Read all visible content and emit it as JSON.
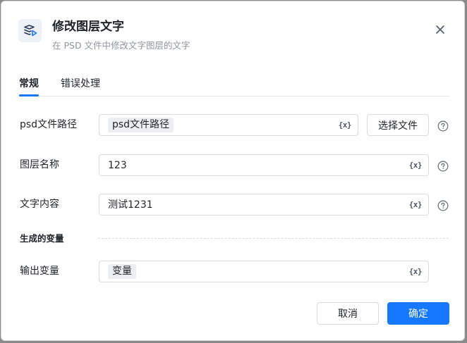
{
  "dialog": {
    "title": "修改图层文字",
    "subtitle": "在 PSD 文件中修改文字图层的文字",
    "icon": "layers-play-icon",
    "close_icon": "close-icon"
  },
  "tabs": [
    {
      "label": "常规",
      "active": true
    },
    {
      "label": "错误处理",
      "active": false
    }
  ],
  "form": {
    "psd_path": {
      "label": "psd文件路径",
      "chip": "psd文件路径",
      "var_icon": "{x}",
      "select_button": "选择文件"
    },
    "layer_name": {
      "label": "图层名称",
      "value": "123",
      "var_icon": "{x}"
    },
    "text_content": {
      "label": "文字内容",
      "value": "测试1231",
      "var_icon": "{x}"
    }
  },
  "generated": {
    "section_title": "生成的变量",
    "output_var": {
      "label": "输出变量",
      "chip": "变量",
      "var_icon": "{x}"
    }
  },
  "footer": {
    "cancel_label": "取消",
    "ok_label": "确定"
  },
  "colors": {
    "accent": "#1677ff",
    "text": "#1f2329",
    "muted": "#8f959e",
    "border": "#d9dce3"
  }
}
